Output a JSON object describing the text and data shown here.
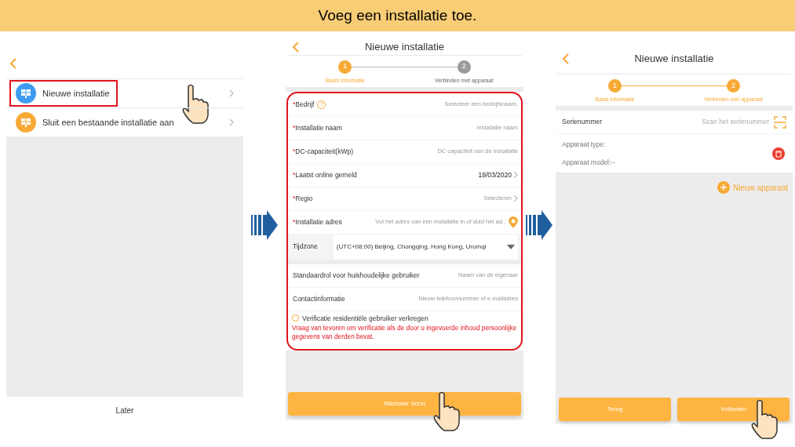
{
  "banner": {
    "title": "Voeg een installatie toe."
  },
  "screen_1": {
    "menu": [
      {
        "label": "Nieuwe installatie",
        "color": "#3d9cf0",
        "tapped": true
      },
      {
        "label": "Sluit een bestaande installatie aan",
        "color": "#f7a935",
        "tapped": false
      }
    ],
    "footer_button": "Later"
  },
  "screen_2": {
    "title": "Nieuwe installatie",
    "steps": [
      {
        "number": "1",
        "label": "Basis informatie",
        "done": true
      },
      {
        "number": "2",
        "label": "Verbinden met apparaat",
        "done": false
      }
    ],
    "highlighted": true,
    "fields": [
      {
        "kind": "text",
        "mark": "*",
        "label": "Bedrijf",
        "help": "?",
        "placeholder": "Selecteer een bedrijfsnaam."
      },
      {
        "kind": "text",
        "mark": "*",
        "label": "Installatie naam",
        "placeholder": "Installatie naam"
      },
      {
        "kind": "text",
        "mark": "*",
        "label": "DC-capaciteit(kWp)",
        "placeholder": "DC capaciteit van de installatie"
      },
      {
        "kind": "picker",
        "mark": "*",
        "label": "Laatst online gemeld",
        "value": "19/03/2020"
      },
      {
        "kind": "picker",
        "mark": "*",
        "label": "Regio",
        "placeholder": "Selecteren"
      },
      {
        "kind": "location",
        "mark": "*",
        "label": "Installatie adres",
        "placeholder": "Vul het adres van een installatie in of duid het ad.."
      },
      {
        "kind": "dropdown",
        "label": "Tijdzone",
        "value": "(UTC+08:00) Beijing, Chongqing, Hong Kong, Urumqi"
      }
    ],
    "owner_fields": [
      {
        "label": "Standaardrol voor huishoudelijke gebruiker",
        "placeholder": "Naam van de eigenaar"
      },
      {
        "label": "Contactinformatie",
        "placeholder": "Nieuw telefoonnummer of e-mailadres"
      }
    ],
    "verification": {
      "label": "Verificatie residentiële gebruiker verkregen",
      "checked": false
    },
    "warning": "Vraag van tevoren om verificatie als de door u ingevoerde inhoud persoonlijke gegevens van derden bevat.",
    "button": {
      "label": "Nächster Schri",
      "tapped": true
    }
  },
  "screen_3": {
    "title": "Nieuwe installatie",
    "steps": [
      {
        "number": "1",
        "label": "Basis informatie",
        "done": true
      },
      {
        "number": "2",
        "label": "Verbinden met apparaat",
        "done": true
      }
    ],
    "serial": {
      "label": "Serienummer",
      "placeholder": "Scan het serienummer"
    },
    "device": [
      "Apparaat type:",
      "Apparaat model:--"
    ],
    "add_button": "Nieuw apparaat",
    "buttons": [
      {
        "label": "Terug",
        "tapped": false
      },
      {
        "label": "Voltooien",
        "tapped": true
      }
    ]
  }
}
